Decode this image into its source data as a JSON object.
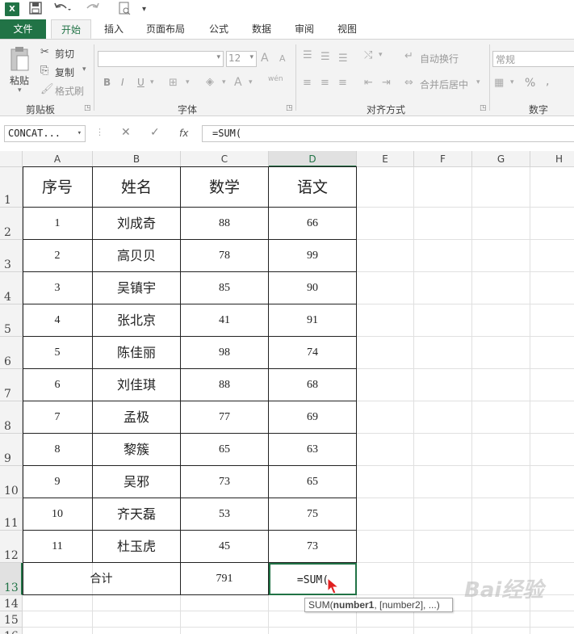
{
  "qat": {
    "logo": "X≣",
    "save": "💾",
    "undo": "↶",
    "redo": "↷",
    "preview": "🗋"
  },
  "tabs": [
    "文件",
    "开始",
    "插入",
    "页面布局",
    "公式",
    "数据",
    "审阅",
    "视图"
  ],
  "ribbon": {
    "clipboard": {
      "label": "剪贴板",
      "paste": "粘贴",
      "cut": "剪切",
      "copy": "复制",
      "format_painter": "格式刷"
    },
    "font": {
      "label": "字体",
      "font_size": "12",
      "bold": "B",
      "italic": "I",
      "underline": "U",
      "grow": "A",
      "shrink": "A",
      "phonetic": "wén"
    },
    "alignment": {
      "label": "对齐方式",
      "wrap_text": "自动换行",
      "merge_center": "合并后居中"
    },
    "number": {
      "label": "数字",
      "format": "常规",
      "percent": "%"
    }
  },
  "formula_bar": {
    "name_box": "CONCAT...",
    "cancel": "✕",
    "enter": "✓",
    "fx": "fx",
    "formula": "=SUM("
  },
  "columns": [
    "A",
    "B",
    "C",
    "D",
    "E",
    "F",
    "G",
    "H"
  ],
  "rows": [
    "1",
    "2",
    "3",
    "4",
    "5",
    "6",
    "7",
    "8",
    "9",
    "10",
    "11",
    "12",
    "13",
    "14",
    "15",
    "16"
  ],
  "table": {
    "headers": [
      "序号",
      "姓名",
      "数学",
      "语文"
    ],
    "rows": [
      [
        "1",
        "刘成奇",
        "88",
        "66"
      ],
      [
        "2",
        "高贝贝",
        "78",
        "99"
      ],
      [
        "3",
        "吴镇宇",
        "85",
        "90"
      ],
      [
        "4",
        "张北京",
        "41",
        "91"
      ],
      [
        "5",
        "陈佳丽",
        "98",
        "74"
      ],
      [
        "6",
        "刘佳琪",
        "88",
        "68"
      ],
      [
        "7",
        "孟极",
        "77",
        "69"
      ],
      [
        "8",
        "黎簇",
        "65",
        "63"
      ],
      [
        "9",
        "吴邪",
        "73",
        "65"
      ],
      [
        "10",
        "齐天磊",
        "53",
        "75"
      ],
      [
        "11",
        "杜玉虎",
        "45",
        "73"
      ]
    ],
    "total_label": "合计",
    "total_math": "791",
    "active_cell_value": "=SUM("
  },
  "tooltip": {
    "fn": "SUM(",
    "arg1": "number1",
    "rest": ", [number2], ...)"
  },
  "watermark": "Bai经验",
  "colors": {
    "accent": "#217346"
  }
}
